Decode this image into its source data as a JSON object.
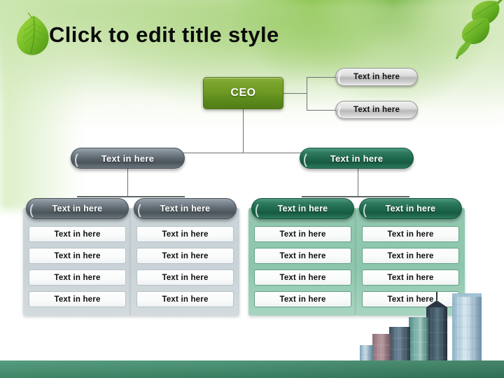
{
  "slide": {
    "title": "Click to edit title style",
    "decorations": {
      "leaf_left": "leaf-icon",
      "branch_right": "leafy-branch-icon",
      "skyline": "city-skyline-image"
    },
    "colors": {
      "ceo_green": "#6d9a22",
      "banner_slate": "#5d686f",
      "banner_green": "#1f6a4e",
      "panel_gray": "#c9d3d7",
      "panel_green": "#8dc6ac",
      "footer_green": "#3d8a69",
      "connector": "#6c7273",
      "title_text": "#0b0b0b"
    }
  },
  "chart_data": {
    "type": "diagram",
    "title": "Click to edit title style",
    "root": {
      "label": "CEO"
    },
    "staff": [
      {
        "label": "Text in here"
      },
      {
        "label": "Text in here"
      }
    ],
    "branches": [
      {
        "label": "Text in here",
        "style": "slate",
        "columns": [
          {
            "header": "Text in here",
            "style": "gray",
            "items": [
              "Text in here",
              "Text in here",
              "Text in here",
              "Text in here"
            ]
          },
          {
            "header": "Text in here",
            "style": "gray",
            "items": [
              "Text in here",
              "Text in here",
              "Text in here",
              "Text in here"
            ]
          }
        ]
      },
      {
        "label": "Text in here",
        "style": "green",
        "columns": [
          {
            "header": "Text in here",
            "style": "green",
            "items": [
              "Text in here",
              "Text in here",
              "Text in here",
              "Text in here"
            ]
          },
          {
            "header": "Text in here",
            "style": "green",
            "items": [
              "Text in here",
              "Text in here",
              "Text in here",
              "Text in here"
            ]
          }
        ]
      }
    ]
  }
}
